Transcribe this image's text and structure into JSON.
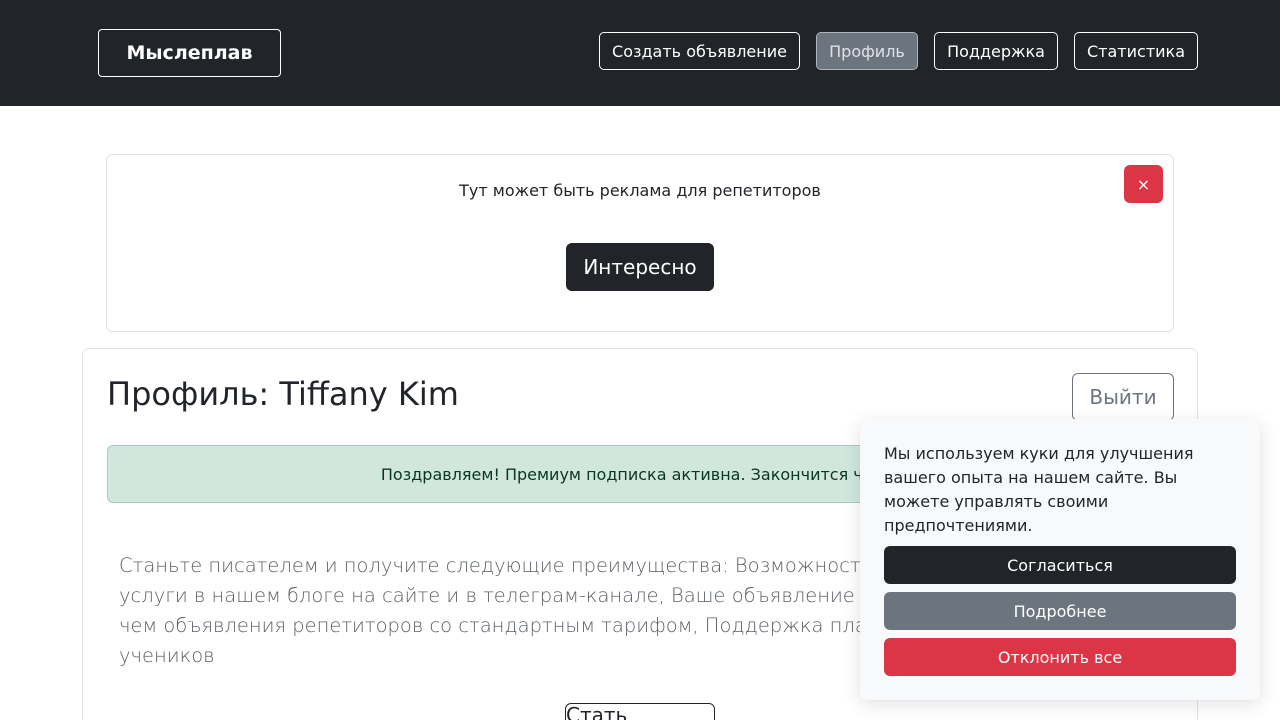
{
  "navbar": {
    "brand": "Мыслеплав",
    "items": [
      {
        "label": "Создать объявление",
        "active": false
      },
      {
        "label": "Профиль",
        "active": true
      },
      {
        "label": "Поддержка",
        "active": false
      },
      {
        "label": "Статистика",
        "active": false
      }
    ]
  },
  "ad": {
    "text": "Тут может быть реклама для репетиторов",
    "close_label": "×",
    "button_label": "Интересно"
  },
  "profile": {
    "title": "Профиль: Tiffany Kim",
    "logout_label": "Выйти",
    "alert_text": "Поздравляем! Премиум подписка активна. Закончится через",
    "lead_text": "Станьте писателем и получите следующие преимущества: Возможность рекламировать свои услуги в нашем блоге на сайте и в телеграм-канале, Ваше объявление будет располагаться выше, чем объявления репетиторов со стандартным тарифом, Поддержка платформы, репетиторов и учеников",
    "bottom_button_label": "Стать писателем"
  },
  "cookie": {
    "text": "Мы используем куки для улучшения вашего опыта на нашем сайте. Вы можете управлять своими предпочтениями.",
    "accept_label": "Согласиться",
    "more_label": "Подробнее",
    "reject_label": "Отклонить все"
  },
  "colors": {
    "navbar_bg": "#212529",
    "danger": "#dc3545",
    "secondary": "#6c757d",
    "success_bg": "#d1e7dd"
  }
}
